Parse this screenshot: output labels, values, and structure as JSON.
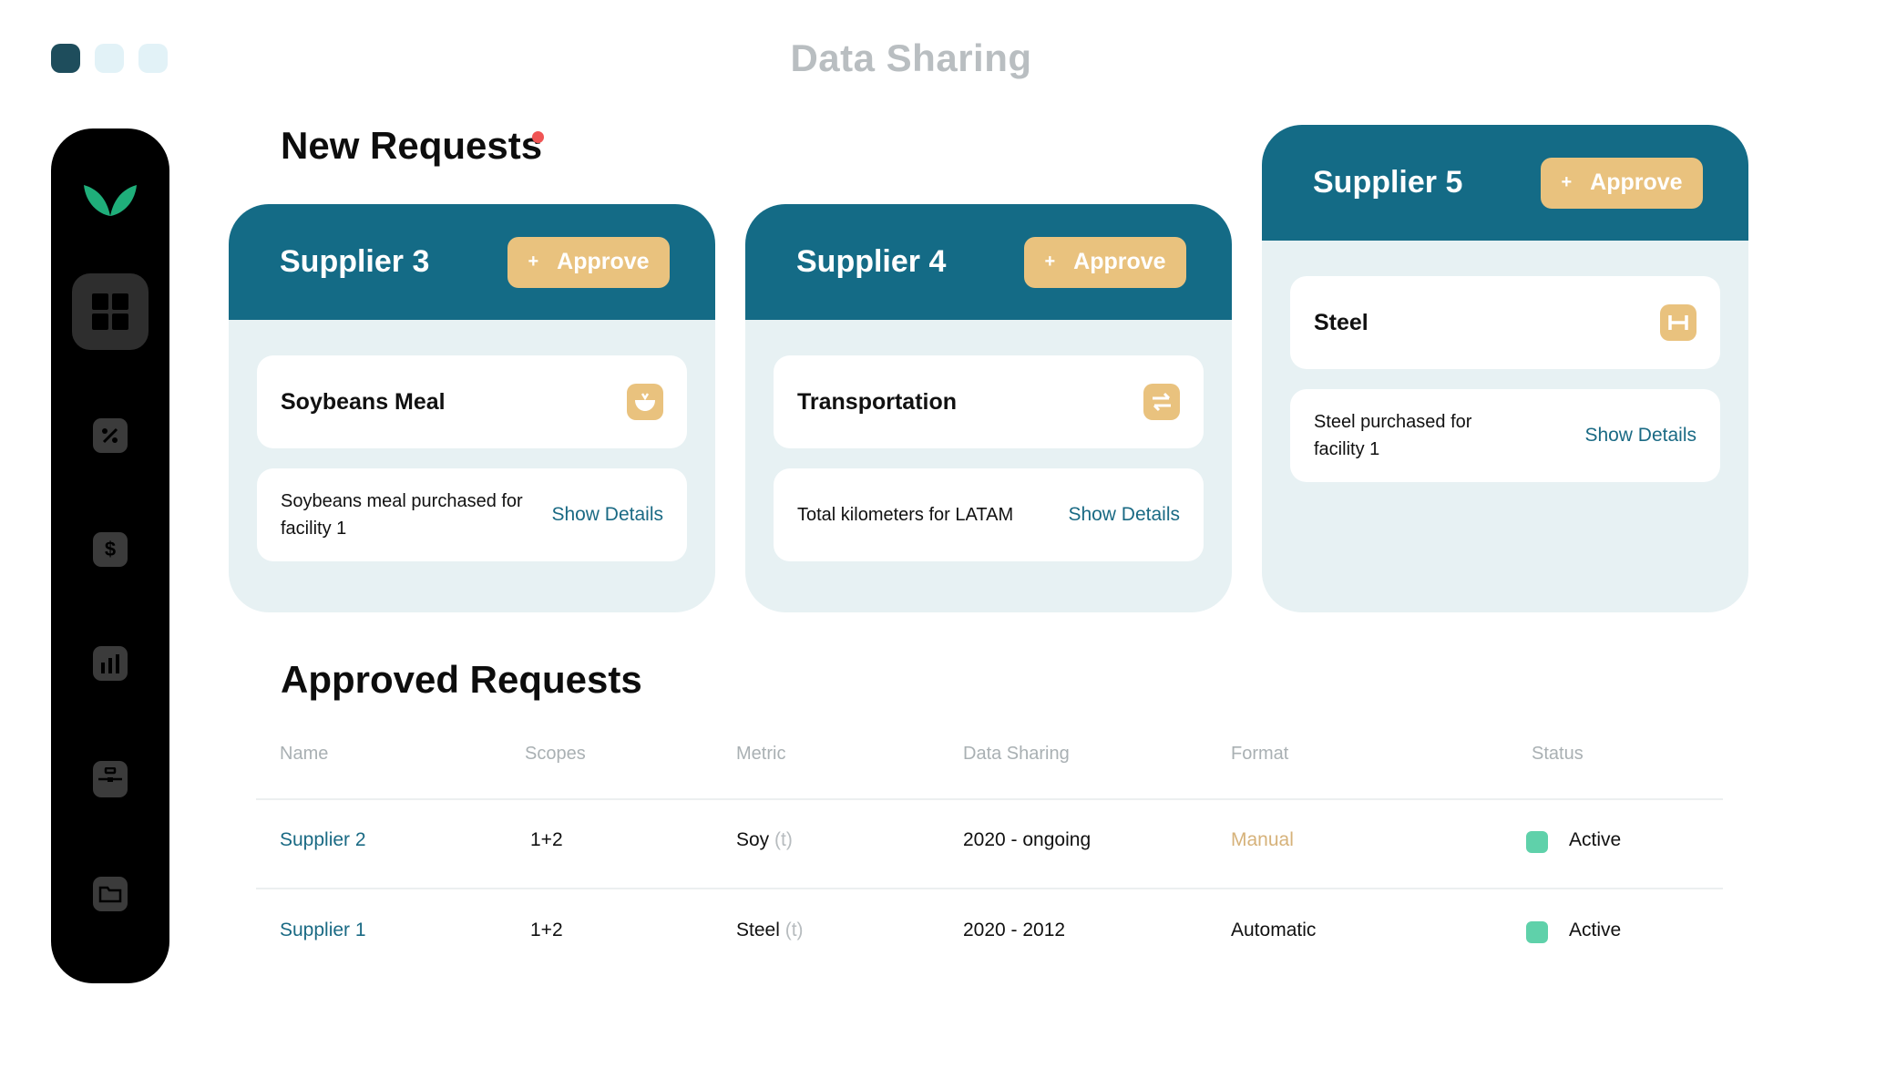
{
  "window": {
    "title": "Data Sharing"
  },
  "sidebar": {
    "logo": "leaf-logo-icon",
    "items": [
      {
        "icon": "dashboard-icon",
        "active": true
      },
      {
        "icon": "analytics-icon",
        "active": false
      },
      {
        "icon": "dollar-icon",
        "glyph": "$",
        "active": false
      },
      {
        "icon": "bar-chart-icon",
        "active": false
      },
      {
        "icon": "briefcase-icon",
        "active": false
      },
      {
        "icon": "folder-icon",
        "active": false
      }
    ]
  },
  "new_requests": {
    "title": "New Requests",
    "approve_label": "Approve",
    "approve_plus": "+",
    "cards": [
      {
        "supplier": "Supplier 3",
        "item": "Soybeans Meal",
        "icon": "bowl-icon",
        "description": "Soybeans meal purchased for facility 1",
        "details_label": "Show Details"
      },
      {
        "supplier": "Supplier 4",
        "item": "Transportation",
        "icon": "swap-arrows-icon",
        "description": "Total kilometers for LATAM",
        "details_label": "Show Details"
      },
      {
        "supplier": "Supplier 5",
        "item": "Steel",
        "icon": "steel-beam-icon",
        "description": "Steel purchased for facility 1",
        "details_label": "Show Details"
      }
    ]
  },
  "approved_requests": {
    "title": "Approved Requests",
    "columns": [
      "Name",
      "Scopes",
      "Metric",
      "Data Sharing",
      "Format",
      "Status"
    ],
    "rows": [
      {
        "name": "Supplier 2",
        "scopes": "1+2",
        "metric": "Soy",
        "unit": "(t)",
        "sharing": "2020 - ongoing",
        "format": "Manual",
        "status": "Active"
      },
      {
        "name": "Supplier 1",
        "scopes": "1+2",
        "metric": "Steel",
        "unit": "(t)",
        "sharing": "2020 - 2012",
        "format": "Automatic",
        "status": "Active"
      }
    ]
  },
  "colors": {
    "primary": "#146b86",
    "accent": "#e9c27e",
    "active_status": "#5fd1aa",
    "card_bg": "#e7f1f3"
  }
}
